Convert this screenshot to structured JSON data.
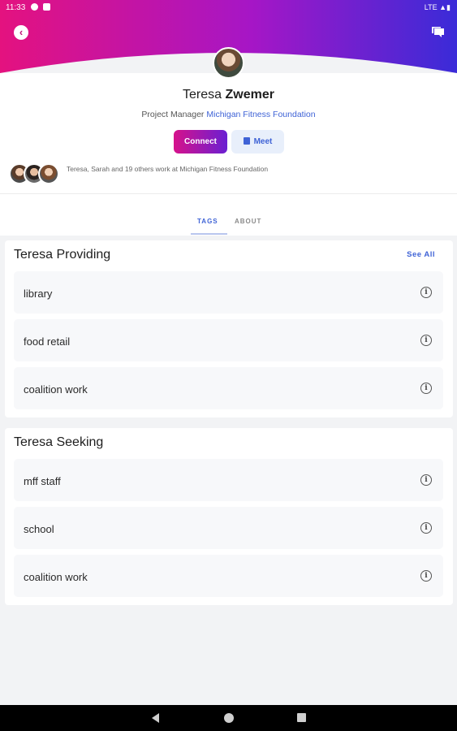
{
  "status_bar": {
    "time": "11:33",
    "network": "LTE"
  },
  "header": {
    "back_icon": "back-arrow-icon",
    "chat_icon": "chat-bubbles-icon"
  },
  "colors": {
    "gradient_start": "#e4127f",
    "gradient_end": "#3a2bd8",
    "accent": "#3f63d6"
  },
  "profile": {
    "first_name": "Teresa",
    "last_name": "Zwemer",
    "role": "Project Manager",
    "organization": "Michigan Fitness Foundation",
    "connect_label": "Connect",
    "meet_label": "Meet",
    "coworkers_text": "Teresa, Sarah and 19 others work at Michigan Fitness Foundation"
  },
  "tabs": [
    {
      "label": "TAGS",
      "active": true
    },
    {
      "label": "ABOUT",
      "active": false
    }
  ],
  "providing": {
    "title": "Teresa Providing",
    "see_all": "See All",
    "items": [
      "library",
      "food retail",
      "coalition work"
    ]
  },
  "seeking": {
    "title": "Teresa Seeking",
    "items": [
      "mff staff",
      "school",
      "coalition work"
    ]
  }
}
